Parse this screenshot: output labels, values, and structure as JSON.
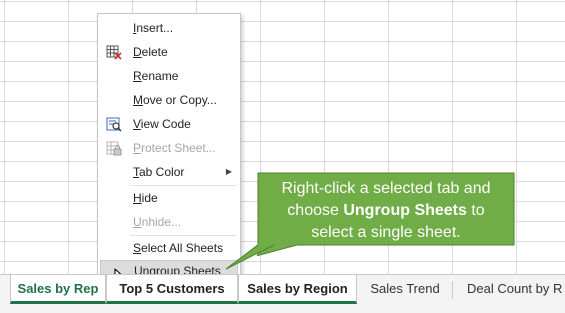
{
  "context_menu": {
    "items": [
      {
        "label_ul": "I",
        "label_rest": "nsert...",
        "disabled": false
      },
      {
        "label_ul": "D",
        "label_rest": "elete",
        "disabled": false,
        "icon": "delete-sheet-icon"
      },
      {
        "label_ul": "R",
        "label_rest": "ename",
        "disabled": false
      },
      {
        "label_ul": "M",
        "label_rest": "ove or Copy...",
        "disabled": false
      },
      {
        "label_ul": "V",
        "label_rest": "iew Code",
        "disabled": false,
        "icon": "view-code-icon"
      },
      {
        "label_ul": "P",
        "label_rest": "rotect Sheet...",
        "disabled": true,
        "icon": "protect-sheet-icon"
      },
      {
        "label_ul": "T",
        "label_rest": "ab Color",
        "disabled": false,
        "submenu": true
      },
      {
        "label_ul": "H",
        "label_rest": "ide",
        "disabled": false
      },
      {
        "label_ul": "U",
        "label_rest": "nhide...",
        "disabled": true
      },
      {
        "label_ul": "S",
        "label_rest": "elect All Sheets",
        "disabled": false
      },
      {
        "label_ul": "U",
        "label_rest": "ngroup Sheets",
        "disabled": false,
        "highlighted": true
      }
    ]
  },
  "callout": {
    "line1": "Right-click a selected tab and",
    "line2_pre": "choose ",
    "line2_bold": "Ungroup Sheets",
    "line2_post": " to",
    "line3": "select a single sheet.",
    "color": "#70ad47"
  },
  "sheet_tabs": [
    {
      "label": "Sales by Rep",
      "selected": true,
      "active": true
    },
    {
      "label": "Top 5 Customers",
      "selected": true,
      "active": false
    },
    {
      "label": "Sales by Region",
      "selected": true,
      "active": false
    },
    {
      "label": "Sales Trend",
      "selected": false,
      "active": false
    },
    {
      "label": "Deal Count by R",
      "selected": false,
      "active": false
    }
  ],
  "colors": {
    "excel_green": "#217346",
    "callout_green": "#70ad47"
  }
}
